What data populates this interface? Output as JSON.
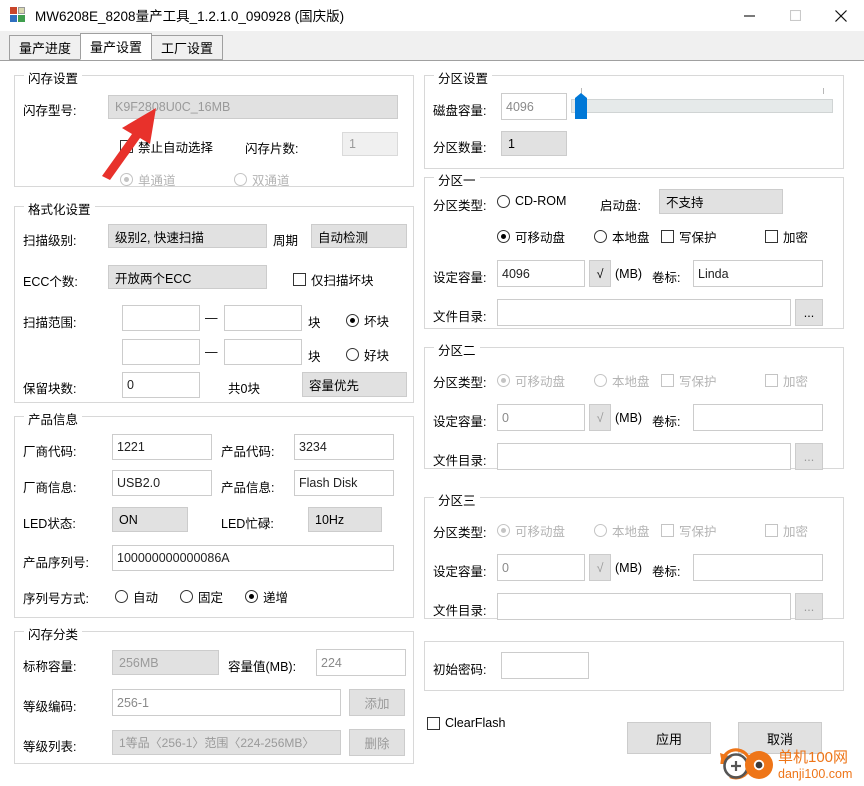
{
  "window": {
    "title": "MW6208E_8208量产工具_1.2.1.0_090928 (国庆版)",
    "icon": "app-blocks-icon",
    "minimize": "—",
    "maximize": "□",
    "close": "✕"
  },
  "tabs": [
    {
      "label": "量产进度",
      "active": false
    },
    {
      "label": "量产设置",
      "active": true
    },
    {
      "label": "工厂设置",
      "active": false
    }
  ],
  "flash_settings": {
    "title": "闪存设置",
    "model_label": "闪存型号:",
    "model_value": "K9F2808U0C_16MB",
    "disable_auto_label": "禁止自动选择",
    "disable_auto_checked": false,
    "chip_count_label": "闪存片数:",
    "chip_count_value": "1",
    "single_channel_label": "单通道",
    "single_channel_selected": true,
    "dual_channel_label": "双通道",
    "dual_channel_selected": false
  },
  "format_settings": {
    "title": "格式化设置",
    "scan_level_label": "扫描级别:",
    "scan_level_value": "级别2, 快速扫描",
    "cycle_label": "周期",
    "cycle_value": "自动检测",
    "ecc_label": "ECC个数:",
    "ecc_value": "开放两个ECC",
    "scan_bad_only_label": "仅扫描坏块",
    "scan_bad_only_checked": false,
    "scan_range_label": "扫描范围:",
    "range1_from": "",
    "range1_to": "",
    "range2_from": "",
    "range2_to": "",
    "unit_block": "块",
    "bad_block_label": "坏块",
    "bad_block_selected": true,
    "good_block_label": "好块",
    "good_block_selected": false,
    "reserved_label": "保留块数:",
    "reserved_value": "0",
    "total_blocks_text": "共0块",
    "priority_value": "容量优先"
  },
  "product_info": {
    "title": "产品信息",
    "vendor_code_label": "厂商代码:",
    "vendor_code_value": "1221",
    "product_code_label": "产品代码:",
    "product_code_value": "3234",
    "vendor_info_label": "厂商信息:",
    "vendor_info_value": "USB2.0",
    "product_info_label": "产品信息:",
    "product_info_value": "Flash Disk",
    "led_state_label": "LED状态:",
    "led_state_value": "ON",
    "led_busy_label": "LED忙碌:",
    "led_busy_value": "10Hz",
    "serial_label": "产品序列号:",
    "serial_value": "100000000000086A",
    "serial_mode_label": "序列号方式:",
    "serial_auto_label": "自动",
    "serial_auto_selected": false,
    "serial_fixed_label": "固定",
    "serial_fixed_selected": false,
    "serial_incr_label": "递增",
    "serial_incr_selected": true
  },
  "flash_class": {
    "title": "闪存分类",
    "nominal_label": "标称容量:",
    "nominal_value": "256MB",
    "capacity_label": "容量值(MB):",
    "capacity_value": "224",
    "grade_code_label": "等级编码:",
    "grade_code_value": "256-1",
    "add_button": "添加",
    "grade_list_label": "等级列表:",
    "grade_list_value": "1等品〈256-1〉范围〈224-256MB〉",
    "delete_button": "删除"
  },
  "partition_settings": {
    "title": "分区设置",
    "disk_capacity_label": "磁盘容量:",
    "disk_capacity_value": "4096",
    "partition_count_label": "分区数量:",
    "partition_count_value": "1"
  },
  "partition_one": {
    "title": "分区一",
    "type_label": "分区类型:",
    "cdrom_label": "CD-ROM",
    "cdrom_selected": false,
    "boot_label": "启动盘:",
    "boot_value": "不支持",
    "removable_label": "可移动盘",
    "removable_selected": true,
    "local_label": "本地盘",
    "local_selected": false,
    "write_protect_label": "写保护",
    "write_protect_checked": false,
    "encrypt_label": "加密",
    "encrypt_checked": false,
    "set_capacity_label": "设定容量:",
    "set_capacity_value": "4096",
    "check_glyph": "√",
    "mb_label": "(MB)",
    "volume_label": "卷标:",
    "volume_value": "Linda",
    "file_dir_label": "文件目录:",
    "file_dir_value": "",
    "browse_button": "..."
  },
  "partition_two": {
    "title": "分区二",
    "type_label": "分区类型:",
    "removable_label": "可移动盘",
    "removable_selected": true,
    "local_label": "本地盘",
    "local_selected": false,
    "write_protect_label": "写保护",
    "write_protect_checked": false,
    "encrypt_label": "加密",
    "encrypt_checked": false,
    "set_capacity_label": "设定容量:",
    "set_capacity_value": "0",
    "check_glyph": "√",
    "mb_label": "(MB)",
    "volume_label": "卷标:",
    "volume_value": "",
    "file_dir_label": "文件目录:",
    "file_dir_value": "",
    "browse_button": "..."
  },
  "partition_three": {
    "title": "分区三",
    "type_label": "分区类型:",
    "removable_label": "可移动盘",
    "removable_selected": true,
    "local_label": "本地盘",
    "local_selected": false,
    "write_protect_label": "写保护",
    "write_protect_checked": false,
    "encrypt_label": "加密",
    "encrypt_checked": false,
    "set_capacity_label": "设定容量:",
    "set_capacity_value": "0",
    "check_glyph": "√",
    "mb_label": "(MB)",
    "volume_label": "卷标:",
    "volume_value": "",
    "file_dir_label": "文件目录:",
    "file_dir_value": "",
    "browse_button": "..."
  },
  "password_box": {
    "initial_password_label": "初始密码:",
    "initial_password_value": ""
  },
  "footer": {
    "clearflash_label": "ClearFlash",
    "clearflash_checked": false,
    "apply_button": "应用",
    "cancel_button": "取消"
  },
  "watermark": {
    "title": "单机100网",
    "url": "danji100.com",
    "color": "#ee7518"
  },
  "annotation": {
    "arrow_color": "#e8312b",
    "points_to": "flash-model-combo"
  }
}
